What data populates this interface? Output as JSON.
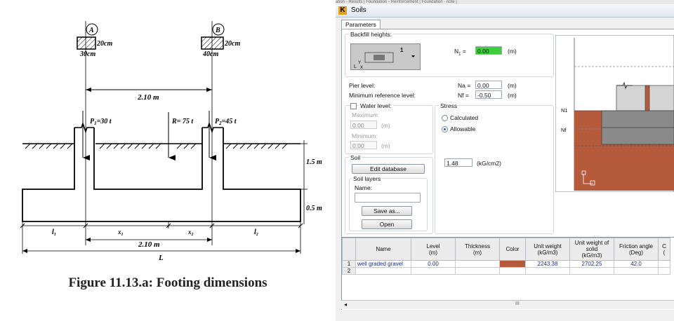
{
  "figure": {
    "col_a_label": "A",
    "col_b_label": "B",
    "col_a_height": "20cm",
    "col_a_width": "30cm",
    "col_b_height": "20cm",
    "col_b_width": "40cm",
    "top_spacing": "2.10 m",
    "load_p1": "=30 t",
    "load_r": "R= 75 t",
    "load_p2": "=45 t",
    "depth_label": "1.5 m",
    "thickness_label": "0.5 m",
    "dim_l1": "l",
    "dim_x1": "x",
    "dim_x2": "x",
    "dim_l2": "l",
    "bottom_spacing": "2.10 m",
    "dim_total": "L",
    "caption": "Figure 11.13.a: Footing dimensions"
  },
  "window": {
    "top_strip": "ation - Results | Foundation - Reinforcement | Foundation - note |",
    "app_icon": "K",
    "title": "Soils",
    "tab": "Parameters",
    "backfill_heights_title": "Backfill heights:",
    "backfill_selected": "1",
    "n1_label": "N",
    "n1_sub": "1",
    "n1_value": "0.00",
    "unit_m": "(m)",
    "pier_level_label": "Pier level:",
    "min_ref_label": "Minimum reference level:",
    "na_label": "Na =",
    "na_value": "0.00",
    "nf_label": "Nf =",
    "nf_value": "-0.50",
    "water_level_label": "Water level:",
    "maximum_label": "Maximum:",
    "maximum_value": "0.00",
    "minimum_label": "Minimum:",
    "minimum_value": "0.00",
    "stress_title": "Stress",
    "calculated_label": "Calculated",
    "allowable_label": "Allowable",
    "stress_value": "1.48",
    "stress_unit": "(kG/cm2)",
    "soil_title": "Soil",
    "edit_database": "Edit database",
    "soil_layers_title": "Soil layers",
    "name_label": "Name:",
    "name_value": "",
    "save_as": "Save as...",
    "open": "Open",
    "section_n1": "N1",
    "section_nf": "Nf",
    "scroll_indicator": "III",
    "colors": {
      "accent_green": "#3bd13b",
      "soil_brown": "#b65a3c",
      "footing_gray": "#8a8a8a"
    }
  },
  "table": {
    "headers": [
      "Name",
      "Level\n(m)",
      "Thickness\n(m)",
      "Color",
      "Unit weight\n(kG/m3)",
      "Unit weight of\nsolid\n(kG/m3)",
      "Friction angle\n(Deg)",
      "C\n("
    ],
    "rows": [
      {
        "num": "1",
        "name": "well graded gravel",
        "level": "0.00",
        "thickness": "",
        "color": "#b65a3c",
        "unit_weight": "2243.38",
        "unit_weight_solid": "2702.25",
        "friction": "42.0",
        "c": ""
      },
      {
        "num": "2",
        "name": "",
        "level": "",
        "thickness": "",
        "color": "",
        "unit_weight": "",
        "unit_weight_solid": "",
        "friction": "",
        "c": ""
      }
    ]
  }
}
